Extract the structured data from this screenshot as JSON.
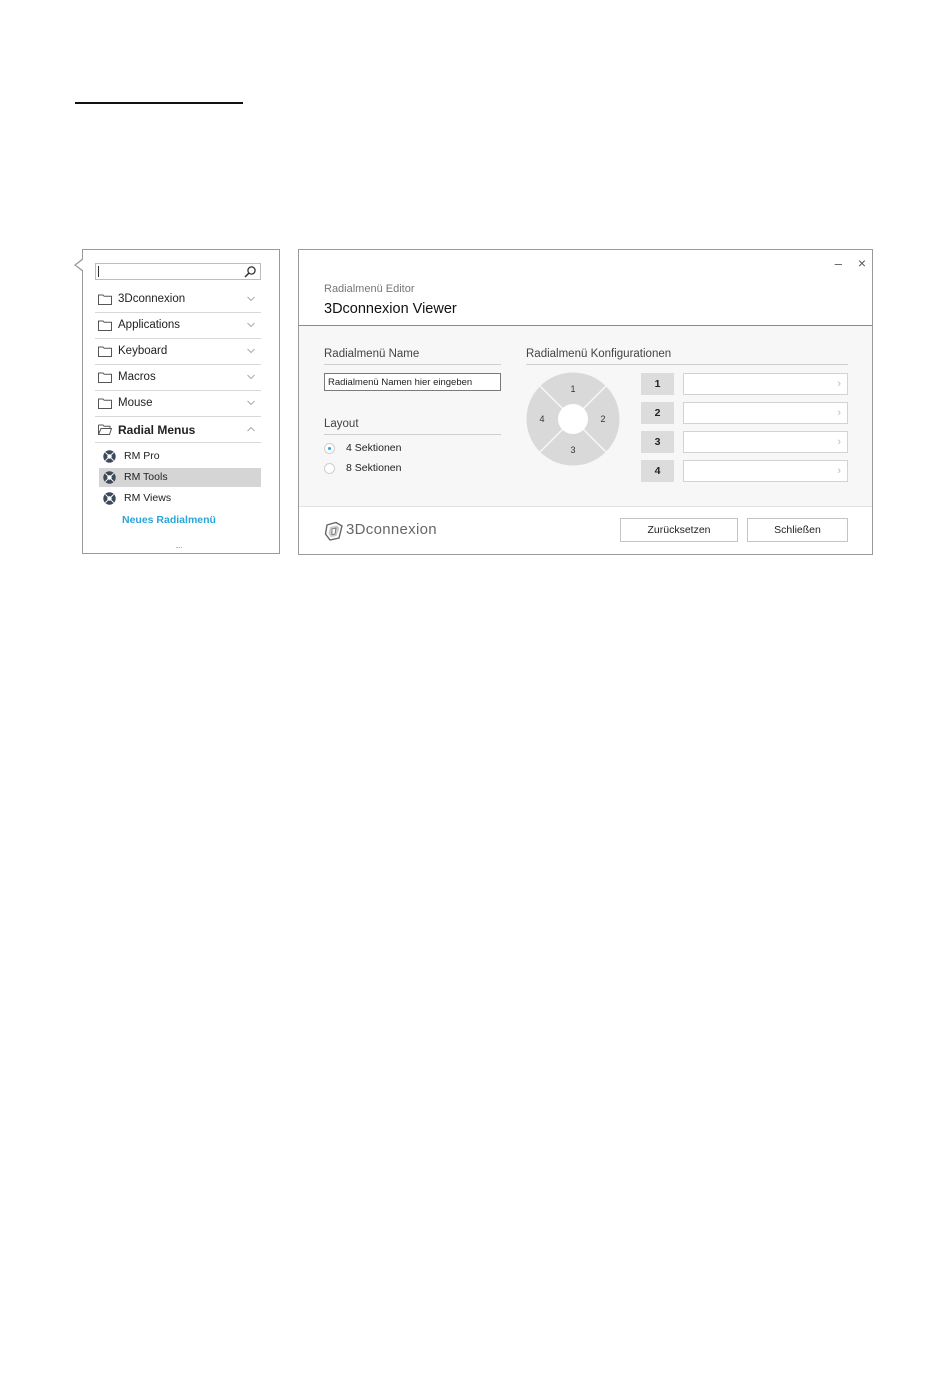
{
  "sidebar": {
    "search": {
      "value": "",
      "icon": "search-icon"
    },
    "items": [
      {
        "label": "3Dconnexion",
        "expanded": false
      },
      {
        "label": "Applications",
        "expanded": false
      },
      {
        "label": "Keyboard",
        "expanded": false
      },
      {
        "label": "Macros",
        "expanded": false
      },
      {
        "label": "Mouse",
        "expanded": false
      },
      {
        "label": "Radial Menus",
        "expanded": true
      }
    ],
    "radial_menus": [
      {
        "label": "RM Pro",
        "selected": false
      },
      {
        "label": "RM Tools",
        "selected": true
      },
      {
        "label": "RM Views",
        "selected": false
      }
    ],
    "new_radial_menu": "Neues Radialmenü",
    "grip": "····"
  },
  "editor": {
    "subtitle": "Radialmenü Editor",
    "title": "3Dconnexion Viewer",
    "window_controls": {
      "minimize": "–",
      "close": "×"
    },
    "name_section": {
      "heading": "Radialmenü Name",
      "input_value": "Radialmenü Namen hier eingeben"
    },
    "layout_section": {
      "heading": "Layout",
      "options": [
        {
          "label": "4 Sektionen",
          "checked": true
        },
        {
          "label": "8 Sektionen",
          "checked": false
        }
      ]
    },
    "config_section": {
      "heading": "Radialmenü Konfigurationen",
      "radial_labels": [
        "1",
        "2",
        "3",
        "4"
      ],
      "slots": [
        {
          "number": "1",
          "value": ""
        },
        {
          "number": "2",
          "value": ""
        },
        {
          "number": "3",
          "value": ""
        },
        {
          "number": "4",
          "value": ""
        }
      ],
      "slot_arrow": "›"
    },
    "footer": {
      "logo_text": "3Dconnexion",
      "reset_label": "Zurücksetzen",
      "close_label": "Schließen"
    }
  },
  "colors": {
    "accent": "#2aa6d8",
    "selected_row": "#d5d5d5",
    "radial_fill": "#d9d9d9"
  }
}
